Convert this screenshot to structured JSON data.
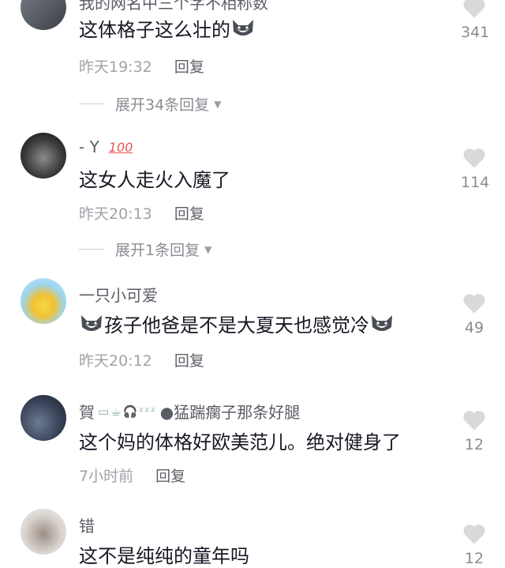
{
  "comments": [
    {
      "username": "我的网名中三个字不相称数",
      "text": "这体格子这么壮的",
      "time": "昨天19:32",
      "reply": "回复",
      "expand": "展开34条回复",
      "likes": "341"
    },
    {
      "username": "-  Y",
      "badge": "100",
      "text": "这女人走火入魔了",
      "time": "昨天20:13",
      "reply": "回复",
      "expand": "展开1条回复",
      "likes": "114"
    },
    {
      "username": "一只小可爱",
      "text": "孩子他爸是不是大夏天也感觉冷",
      "time": "昨天20:12",
      "reply": "回复",
      "likes": "49"
    },
    {
      "username_prefix": "賀",
      "username": "●猛踹瘸子那条好腿",
      "text": "这个妈的体格好欧美范儿。绝对健身了",
      "time": "7小时前",
      "reply": "回复",
      "likes": "12"
    },
    {
      "username": "错",
      "text": "这不是纯纯的童年吗",
      "likes": "12"
    }
  ],
  "colors": {
    "text": "#161823",
    "muted": "#a0a2a8",
    "heart": "#d9d9dc"
  }
}
